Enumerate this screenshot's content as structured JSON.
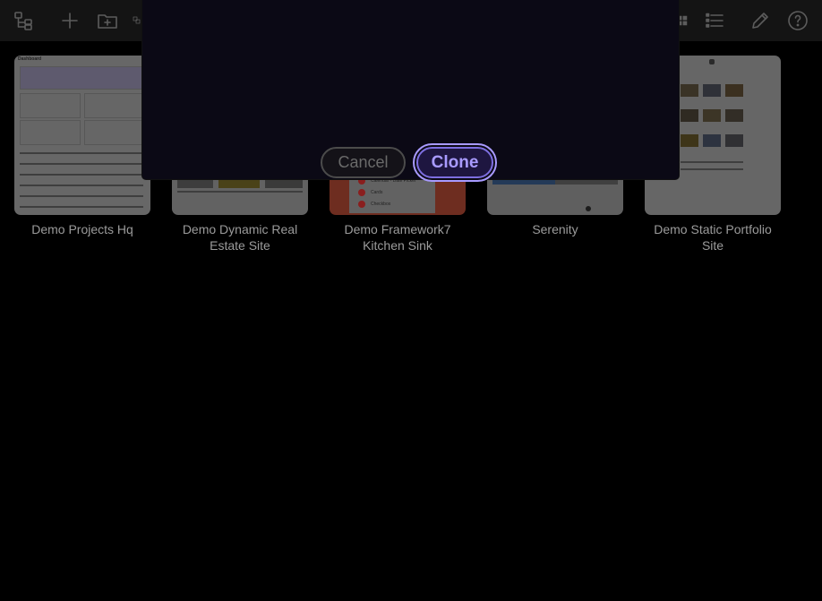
{
  "dialog": {
    "cancel_label": "Cancel",
    "clone_label": "Clone"
  },
  "projects": [
    {
      "name": "Demo Projects Hq"
    },
    {
      "name": "Demo Dynamic Real Estate Site"
    },
    {
      "name": "Demo Framework7 Kitchen Sink"
    },
    {
      "name": "Serenity"
    },
    {
      "name": "Demo Static Portfolio Site"
    }
  ],
  "thumbnails": {
    "projects_hq": {
      "header": "Dashboard"
    },
    "kitchen_sink": {
      "items": [
        "Calendar - Date Picker",
        "Cards",
        "Checkbox"
      ]
    }
  },
  "colors": {
    "accent": "#a99bff",
    "toolbar_bg": "#141414",
    "dialog_bg": "#0b0915"
  },
  "icons": {
    "left": [
      "sitemap-icon",
      "plus-icon",
      "folder-plus-icon",
      "clone-icon"
    ],
    "right": [
      "grid-view-icon",
      "list-view-icon",
      "pencil-icon",
      "help-icon"
    ]
  }
}
